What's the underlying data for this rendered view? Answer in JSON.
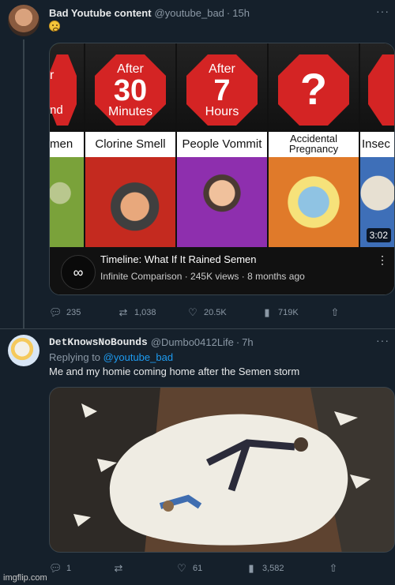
{
  "tweet1": {
    "name": "Bad Youtube content",
    "handle": "@youtube_bad",
    "time": "15h",
    "card": {
      "panels": [
        {
          "top": "r",
          "label": "men"
        },
        {
          "top1": "After",
          "top2": "30",
          "top3": "Minutes",
          "label": "Clorine Smell"
        },
        {
          "top1": "After",
          "top2": "7",
          "top3": "Hours",
          "label": "People Vommit"
        },
        {
          "top2": "?",
          "label1": "Accidental",
          "label2": "Pregnancy"
        },
        {
          "label": "Insec"
        }
      ],
      "edge_left_text": "nd",
      "duration": "3:02",
      "channel_logo_text": "∞",
      "title": "Timeline: What If It Rained Semen",
      "subtitle": "Infinite Comparison · 245K views · 8 months ago"
    },
    "actions": {
      "replies": "235",
      "retweets": "1,038",
      "likes": "20.5K",
      "views": "719K"
    }
  },
  "tweet2": {
    "name": "DetKnowsNoBounds",
    "handle": "@Dumbo0412Life",
    "time": "7h",
    "replying_prefix": "Replying to",
    "replying_handle": "@youtube_bad",
    "text": "Me and my homie coming home after the Semen storm",
    "actions": {
      "replies": "1",
      "retweets": "",
      "likes": "61",
      "views": "3,582"
    }
  },
  "watermark": "imgflip.com",
  "colors": {
    "background": "#15202b",
    "accent": "#1d9bf0",
    "octagon": "#d42424"
  }
}
